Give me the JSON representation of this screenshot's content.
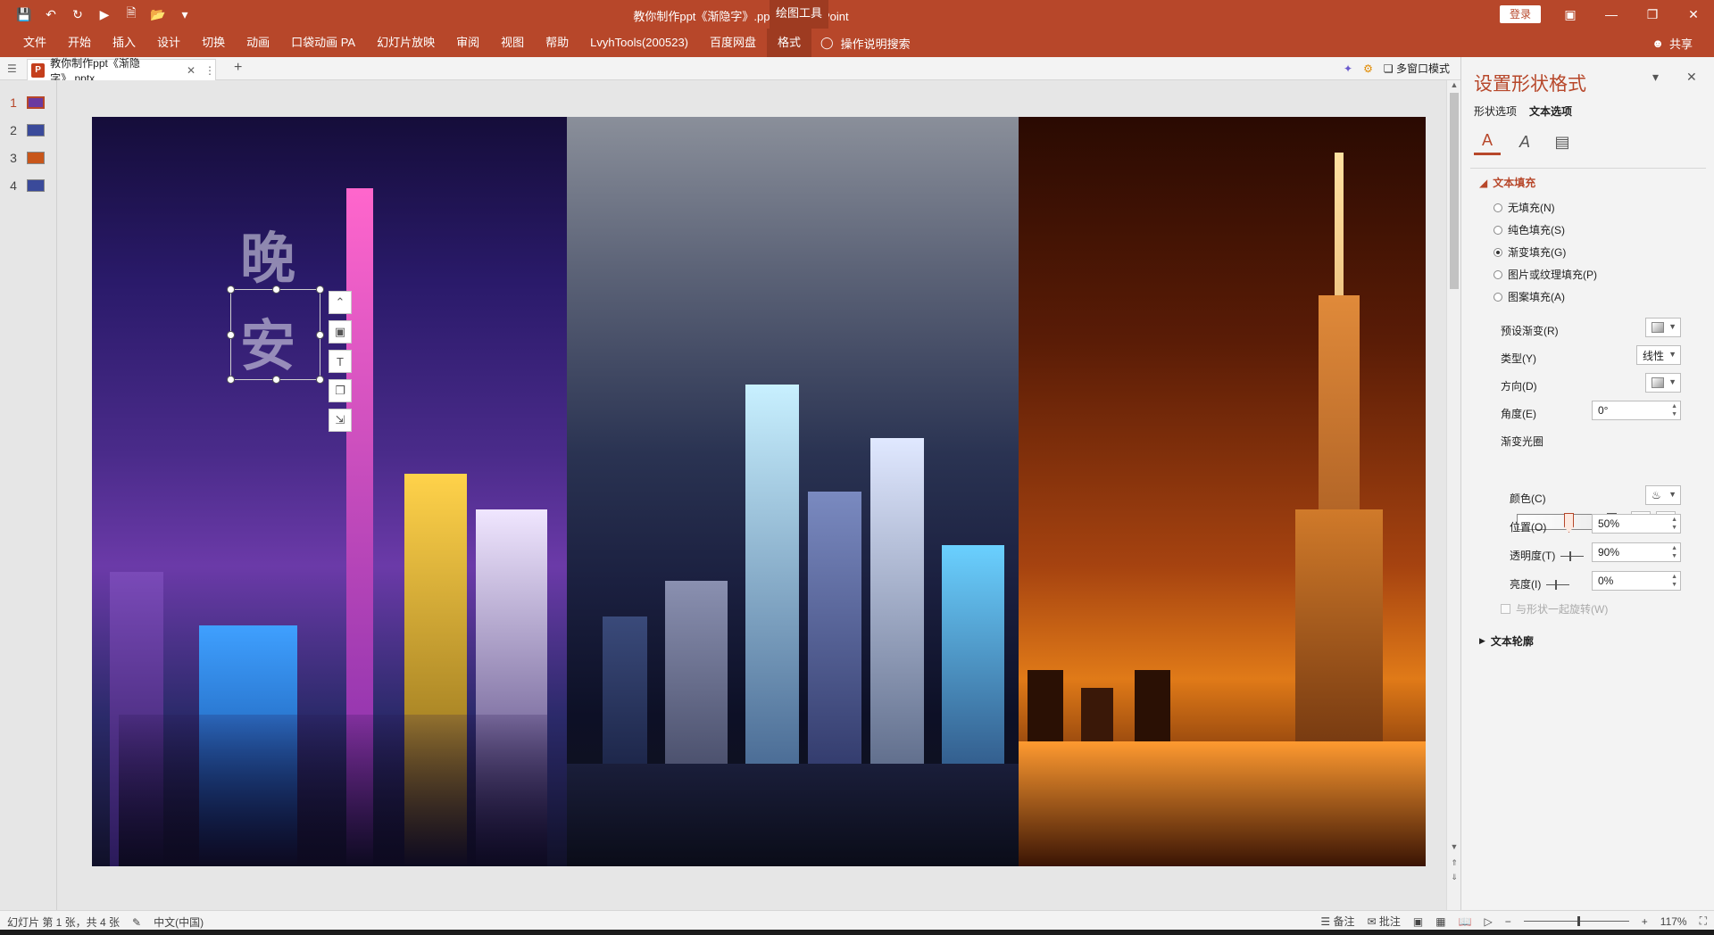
{
  "app": {
    "document_title": "教你制作ppt《渐隐字》.pptx  -  PowerPoint",
    "context_tab_group": "绘图工具",
    "login_label": "登录"
  },
  "ribbon": {
    "tabs": [
      "文件",
      "开始",
      "插入",
      "设计",
      "切换",
      "动画",
      "口袋动画 PA",
      "幻灯片放映",
      "审阅",
      "视图",
      "帮助",
      "LvyhTools(200523)",
      "百度网盘",
      "格式"
    ],
    "active_tab": "格式",
    "tell_me": "操作说明搜索",
    "share": "共享"
  },
  "tabbar": {
    "doc_tab": "教你制作ppt《渐隐字》.pptx",
    "multi_window": "多窗口模式"
  },
  "thumbnails": [
    {
      "num": "1",
      "active": true,
      "color": "#6a3aa0"
    },
    {
      "num": "2",
      "active": false,
      "color": "#3a4a9a"
    },
    {
      "num": "3",
      "active": false,
      "color": "#c8561a"
    },
    {
      "num": "4",
      "active": false,
      "color": "#3a4a9a"
    }
  ],
  "slide": {
    "chars": [
      "晚",
      "安"
    ]
  },
  "format_pane": {
    "title": "设置形状格式",
    "tabs": [
      "形状选项",
      "文本选项"
    ],
    "active_tab": "文本选项",
    "icons": [
      "text-fill-outline-icon",
      "text-effects-icon",
      "textbox-icon"
    ],
    "text_fill": {
      "header": "文本填充",
      "options": [
        {
          "label": "无填充(N)",
          "selected": false
        },
        {
          "label": "纯色填充(S)",
          "selected": false
        },
        {
          "label": "渐变填充(G)",
          "selected": true
        },
        {
          "label": "图片或纹理填充(P)",
          "selected": false
        },
        {
          "label": "图案填充(A)",
          "selected": false
        }
      ],
      "preset_label": "预设渐变(R)",
      "type_label": "类型(Y)",
      "type_value": "线性",
      "direction_label": "方向(D)",
      "angle_label": "角度(E)",
      "angle_value": "0°",
      "stops_label": "渐变光圈",
      "color_label": "颜色(C)",
      "position_label": "位置(O)",
      "position_value": "50%",
      "transparency_label": "透明度(T)",
      "transparency_value": "90%",
      "brightness_label": "亮度(I)",
      "brightness_value": "0%",
      "rotate_with_shape": "与形状一起旋转(W)"
    },
    "text_outline": {
      "header": "文本轮廓"
    }
  },
  "statusbar": {
    "slide_info": "幻灯片 第 1 张，共 4 张",
    "language": "中文(中国)",
    "notes": "备注",
    "comments": "批注",
    "zoom": "117%"
  }
}
